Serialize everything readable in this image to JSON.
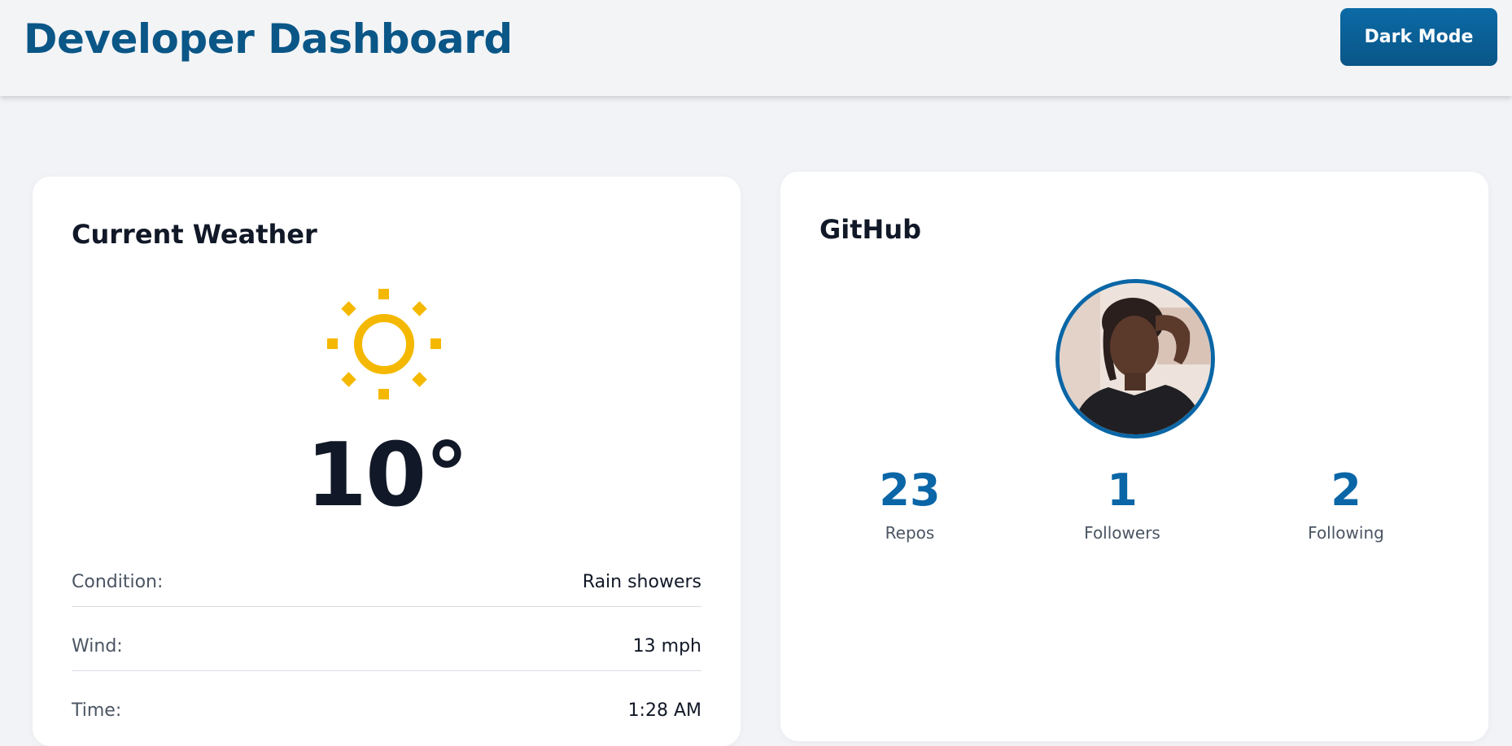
{
  "header": {
    "title": "Developer Dashboard",
    "dark_mode_label": "Dark Mode"
  },
  "weather": {
    "title": "Current Weather",
    "icon": "sun-icon",
    "temperature": "10°",
    "rows": [
      {
        "label": "Condition:",
        "value": "Rain showers"
      },
      {
        "label": "Wind:",
        "value": "13 mph"
      },
      {
        "label": "Time:",
        "value": "1:28 AM"
      }
    ]
  },
  "github": {
    "title": "GitHub",
    "avatar": "profile-photo",
    "stats": [
      {
        "value": "23",
        "label": "Repos"
      },
      {
        "value": "1",
        "label": "Followers"
      },
      {
        "value": "2",
        "label": "Following"
      }
    ]
  },
  "colors": {
    "brand": "#0a5687",
    "accent": "#0a66a6",
    "sun": "#f5b800",
    "background": "#f1f3f6"
  }
}
